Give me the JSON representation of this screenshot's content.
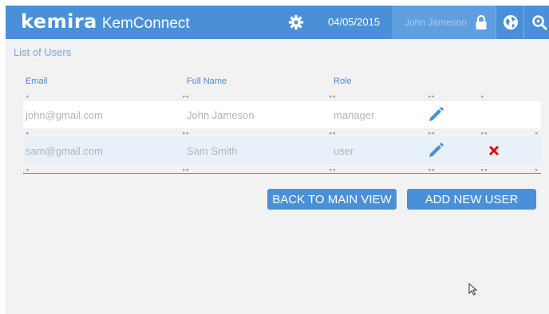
{
  "header": {
    "logo_text": "kemira",
    "app_name": "KemConnect",
    "date": "04/05/2015",
    "user_name": "John Jameson"
  },
  "page": {
    "title": "List of Users"
  },
  "table": {
    "columns": [
      "Email",
      "Full Name",
      "Role"
    ],
    "rows": [
      {
        "email": "john@gmail.com",
        "full_name": "John Jameson",
        "role": "manager",
        "deletable": false
      },
      {
        "email": "sam@gmail.com",
        "full_name": "Sam Smith",
        "role": "user",
        "deletable": true
      }
    ]
  },
  "actions": {
    "back_label": "BACK TO MAIN VIEW",
    "add_label": "ADD NEW USER"
  },
  "colors": {
    "header_bg": "#4a90d9",
    "accent": "#4a90d9",
    "delete": "#e60000",
    "row_alt": "#e8f0f9"
  },
  "icons": [
    "gear-icon",
    "lock-icon",
    "globe-icon",
    "search-icon",
    "pencil-icon",
    "delete-x-icon",
    "mouse-cursor-icon"
  ]
}
